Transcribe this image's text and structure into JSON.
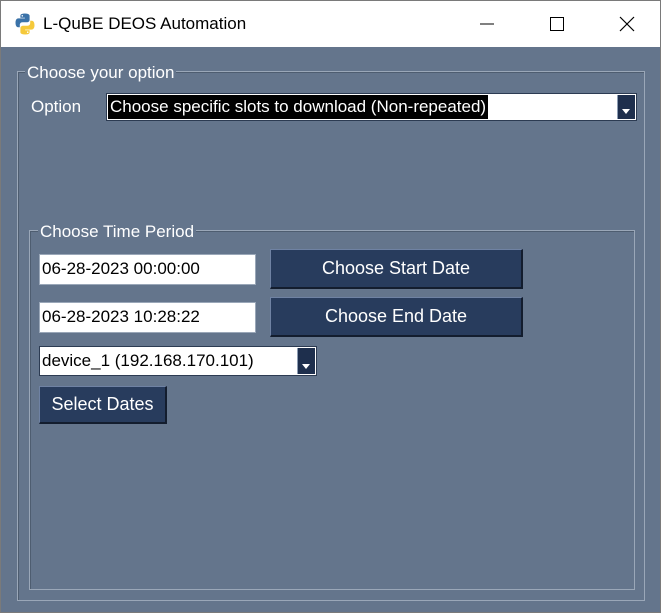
{
  "window": {
    "title": "L-QuBE DEOS Automation",
    "controls": {
      "minimize": "—",
      "maximize": "☐",
      "close": "✕"
    }
  },
  "option_group": {
    "legend": "Choose your option",
    "option_label": "Option",
    "option_selected": "Choose specific slots to download (Non-repeated)"
  },
  "time_group": {
    "legend": "Choose Time Period",
    "start_date_value": "06-28-2023 00:00:00",
    "end_date_value": "06-28-2023 10:28:22",
    "start_button_label": "Choose Start Date",
    "end_button_label": "Choose End Date",
    "device_selected": "device_1 (192.168.170.101)",
    "select_button_label": "Select Dates"
  },
  "colors": {
    "window_bg": "#64758c",
    "button_bg": "#283c5d",
    "arrow_bg": "#1e2f4d"
  }
}
